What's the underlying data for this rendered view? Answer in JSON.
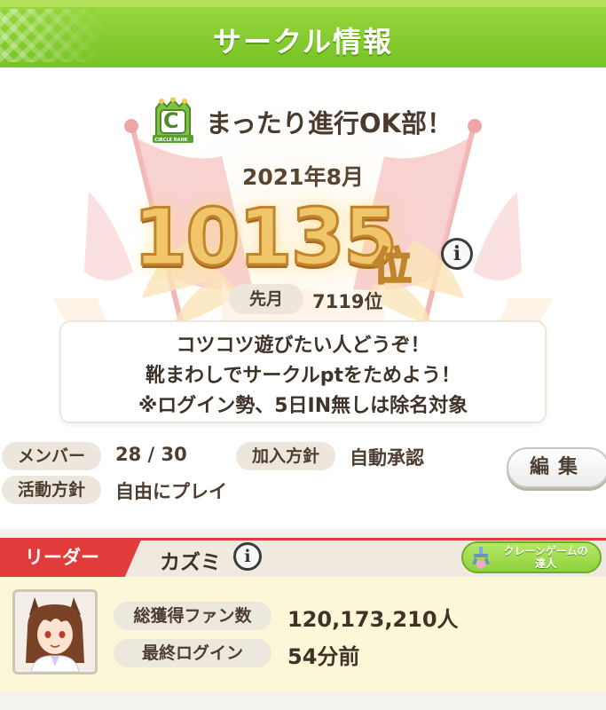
{
  "header": {
    "title": "サークル情報"
  },
  "circle": {
    "rank_badge_letter": "C",
    "rank_badge_caption": "CIRCLE RANK",
    "name": "まったり進行OK部！",
    "period": "2021年8月",
    "rank_number": "10135",
    "rank_suffix": "位",
    "info_icon": "i",
    "last_month_label": "先月",
    "last_month_value": "7119位",
    "description": [
      "コツコツ遊びたい人どうぞ！",
      "靴まわしでサークルptをためよう！",
      "※ログイン勢、5日IN無しは除名対象"
    ]
  },
  "details": {
    "members_label": "メンバー",
    "members_value": "28 / 30",
    "join_policy_label": "加入方針",
    "join_policy_value": "自動承認",
    "activity_label": "活動方針",
    "activity_value": "自由にプレイ",
    "edit_button": "編集"
  },
  "leader": {
    "section_label": "リーダー",
    "name": "カズミ",
    "info_icon": "i",
    "badge_line1": "クレーンゲームの",
    "badge_line2": "達人",
    "fans_label": "総獲得ファン数",
    "fans_value": "120,173,210人",
    "last_login_label": "最終ログイン",
    "last_login_value": "54分前"
  },
  "colors": {
    "header_green": "#8ccf32",
    "leader_red": "#e23b3b",
    "rank_gold": "#f1c56a",
    "pill_beige": "#ece6dd",
    "leader_card_bg": "#fcf7d9"
  },
  "icons": {
    "rank_badge": "circle-rank-badge-icon",
    "info": "info-icon",
    "crane": "crane-game-icon",
    "avatar": "trainer-avatar"
  }
}
